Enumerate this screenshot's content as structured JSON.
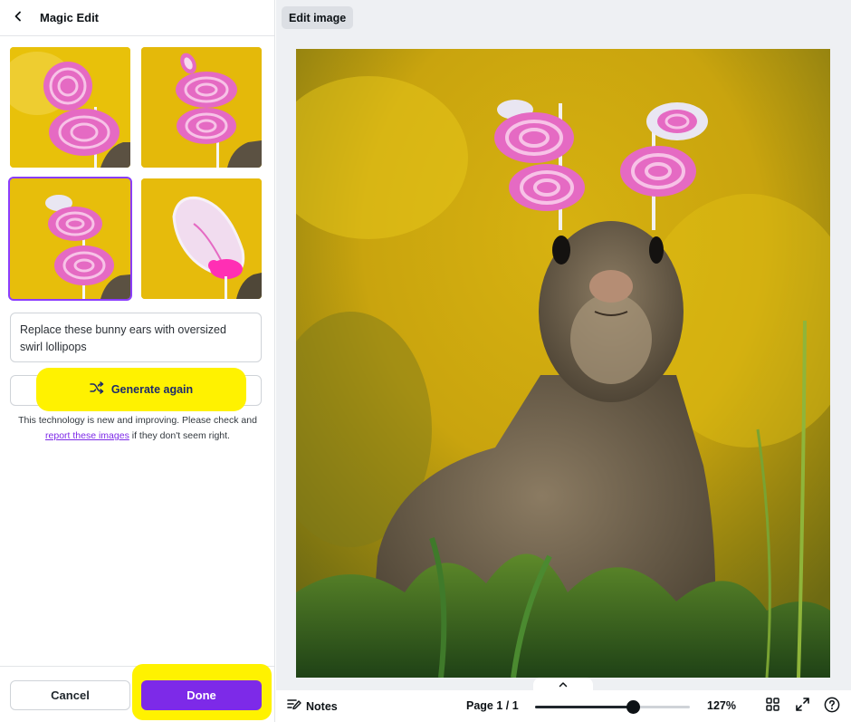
{
  "panel": {
    "back_icon": "chevron-left-icon",
    "title": "Magic Edit"
  },
  "thumbnails": [
    {
      "label": "result-1",
      "selected": false
    },
    {
      "label": "result-2",
      "selected": false
    },
    {
      "label": "result-3",
      "selected": true
    },
    {
      "label": "result-4",
      "selected": false
    }
  ],
  "prompt": {
    "value": "Replace these bunny ears with oversized swirl lollipops"
  },
  "generate": {
    "icon": "shuffle-icon",
    "label": "Generate again"
  },
  "disclaimer": {
    "text_before": "This technology is new and improving. Please check and ",
    "link": "report these images",
    "text_after": " if they don't seem right."
  },
  "footer": {
    "cancel_label": "Cancel",
    "done_label": "Done"
  },
  "toolbar": {
    "edit_image_label": "Edit image"
  },
  "bottom_bar": {
    "notes_label": "Notes",
    "page_label": "Page 1 / 1",
    "zoom_label": "127%",
    "zoom_fraction": 0.63,
    "grid_icon": "grid-view-icon",
    "fullscreen_icon": "fullscreen-icon",
    "help_icon": "help-icon"
  },
  "colors": {
    "accent": "#7d2ae8",
    "highlight": "#fff200",
    "background_yellow": "#e9c407",
    "lollipop_pink": "#e05bbf"
  }
}
